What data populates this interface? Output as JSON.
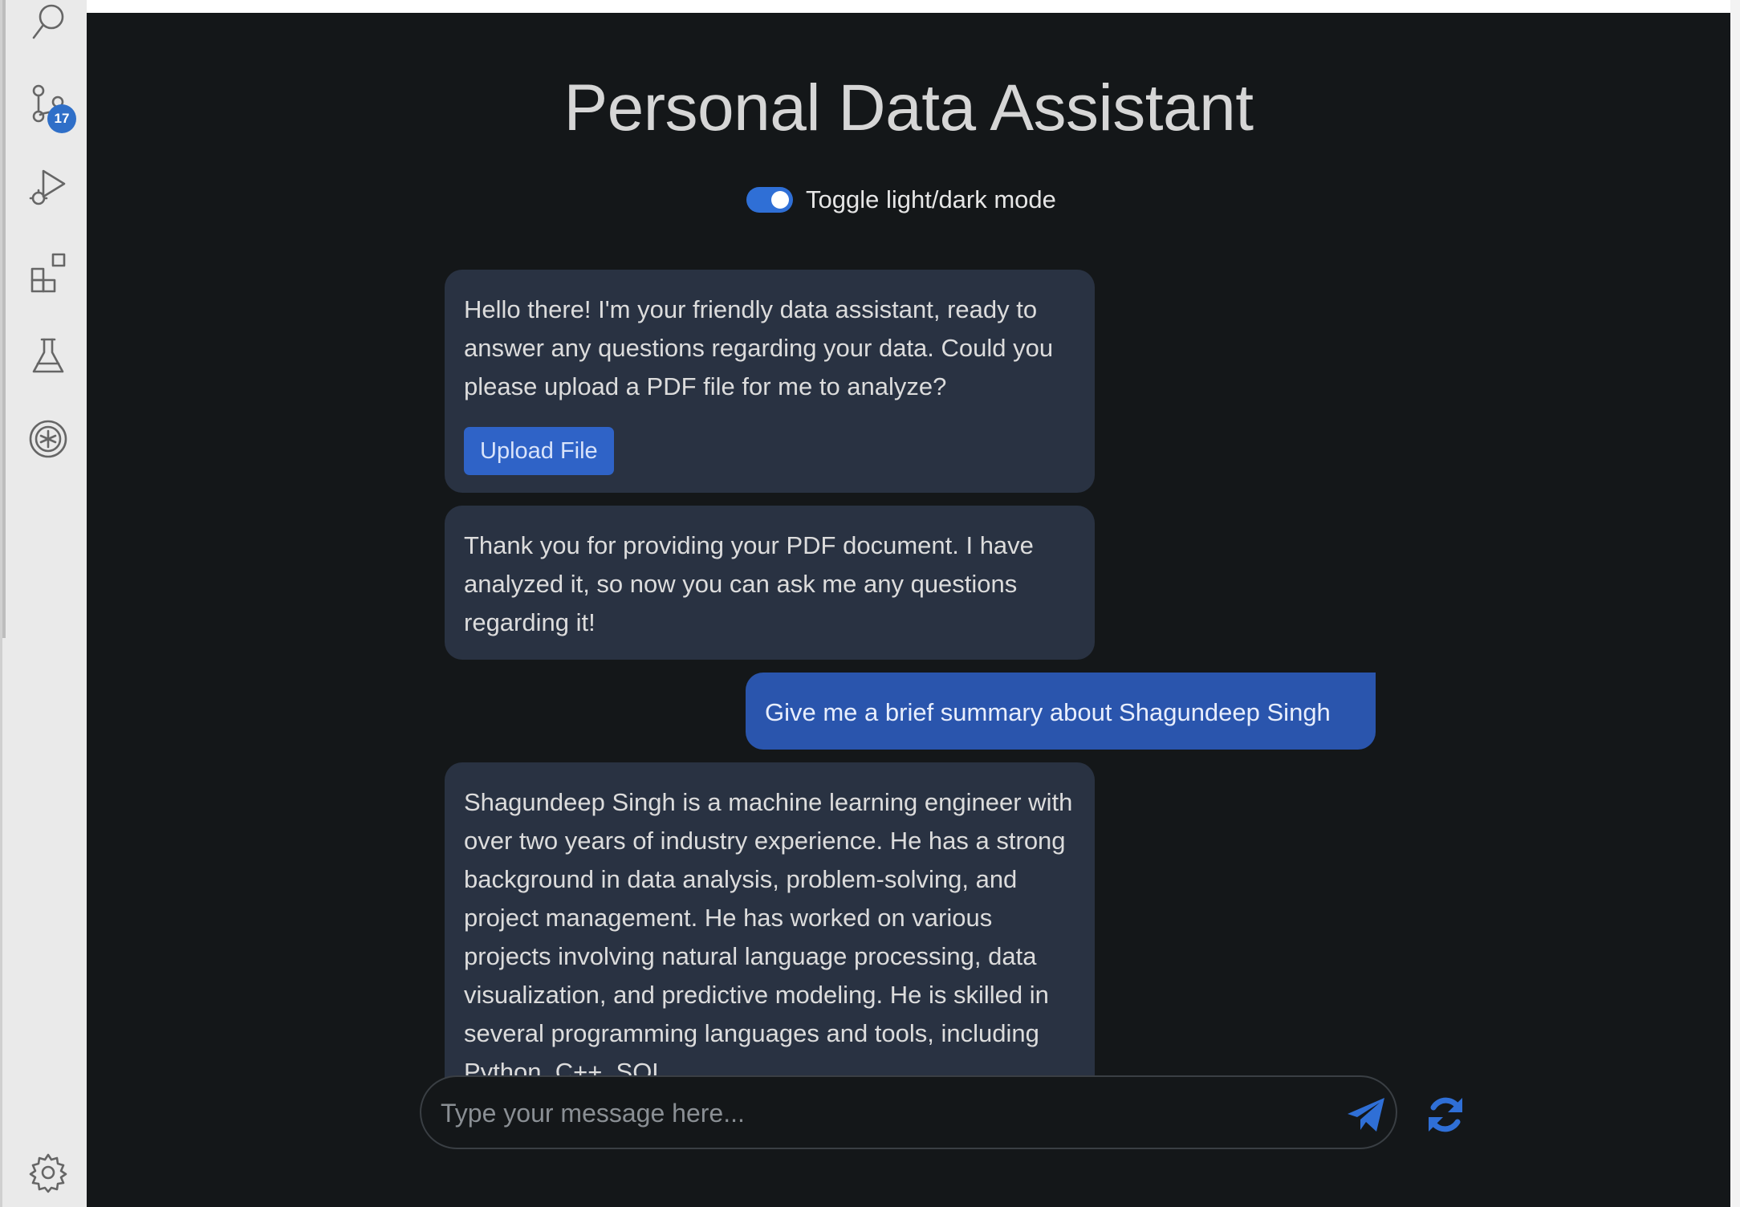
{
  "activity_bar": {
    "icons": [
      "search-icon",
      "source-control-icon",
      "run-debug-icon",
      "extensions-icon",
      "testing-icon",
      "remote-explorer-icon",
      "settings-gear-icon"
    ],
    "source_control_badge": "17"
  },
  "app": {
    "title": "Personal Data Assistant",
    "theme_toggle": {
      "label": "Toggle light/dark mode",
      "enabled": true
    }
  },
  "messages": [
    {
      "role": "assistant",
      "text": "Hello there! I'm your friendly data assistant, ready to answer any questions regarding your data. Could you please upload a PDF file for me to analyze?",
      "button": "Upload File"
    },
    {
      "role": "assistant",
      "text": "Thank you for providing your PDF document. I have analyzed it, so now you can ask me any questions regarding it!"
    },
    {
      "role": "user",
      "text": "Give me a brief summary about Shagundeep Singh"
    },
    {
      "role": "assistant",
      "text": "Shagundeep Singh is a machine learning engineer with over two years of industry experience. He has a strong background in data analysis, problem-solving, and project management. He has worked on various projects involving natural language processing, data visualization, and predictive modeling. He is skilled in several programming languages and tools, including Python, C++, SQL,"
    }
  ],
  "composer": {
    "placeholder": "Type your message here...",
    "value": ""
  },
  "colors": {
    "background": "#141719",
    "assistant_bubble": "#293242",
    "user_bubble": "#2a55ad",
    "accent": "#2f6fd6"
  }
}
